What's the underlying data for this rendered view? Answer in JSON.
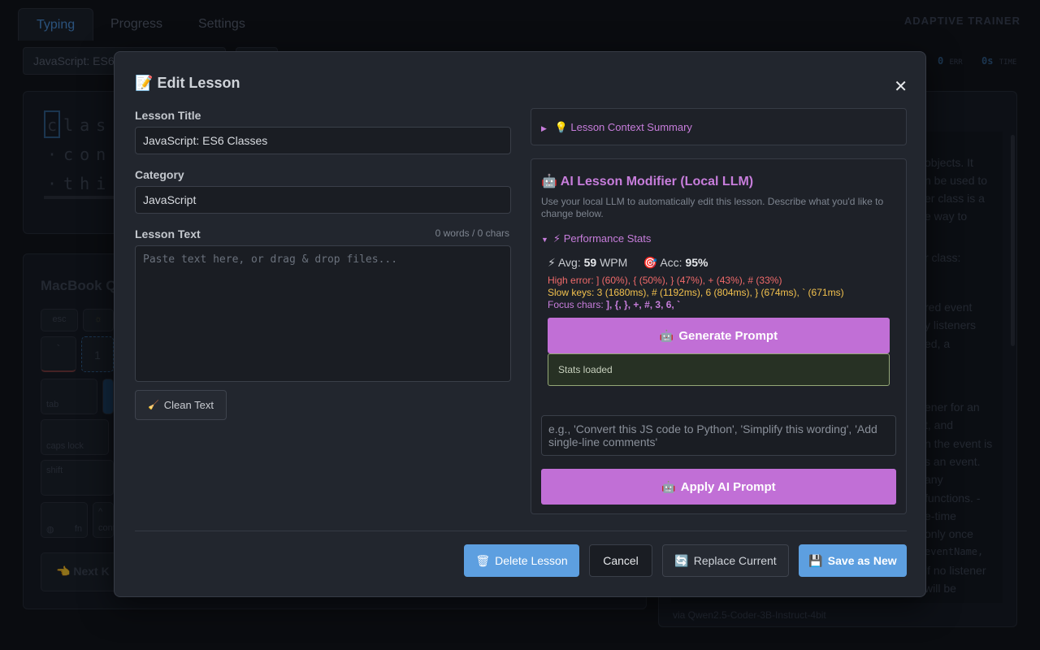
{
  "app": {
    "tabs": [
      {
        "label": "Typing",
        "active": true
      },
      {
        "label": "Progress",
        "active": false
      },
      {
        "label": "Settings",
        "active": false
      }
    ],
    "brand": "ADAPTIVE TRAINER",
    "lesson_select_value": "JavaScript: ES6",
    "stats": [
      {
        "value": "0",
        "unit": "ERR"
      },
      {
        "value": "0s",
        "unit": "TIME"
      }
    ],
    "typing_lines": [
      "class",
      "·con",
      "·thi"
    ],
    "keyboard_title": "MacBook Q",
    "keys": [
      "esc",
      "☼",
      "`",
      "1",
      "tab",
      "caps lock",
      "shift",
      "fn",
      "^",
      "cont"
    ],
    "next_key_label": "Next K",
    "ai_text_lines": [
      "objects. It",
      "n be used to",
      "er class is a",
      "e way to",
      "r class:",
      "red event",
      "y listeners",
      "ed, a",
      "ener for an",
      "t, and",
      "n the event is",
      "s an event.",
      "any",
      "functions. -",
      "e-time",
      "only once",
      "eventName,",
      "lf no listener",
      "will be"
    ],
    "via": "via Qwen2.5-Coder-3B-Instruct-4bit"
  },
  "modal": {
    "title_icon": "📝",
    "title": "Edit Lesson",
    "close_label": "✕",
    "lesson_title_label": "Lesson Title",
    "lesson_title_value": "JavaScript: ES6 Classes",
    "category_label": "Category",
    "category_value": "JavaScript",
    "lesson_text_label": "Lesson Text",
    "lesson_text_count": "0 words / 0 chars",
    "lesson_text_placeholder": "Paste text here, or drag & drop files...",
    "clean_text_icon": "🧹",
    "clean_text_label": "Clean Text",
    "context_summary": {
      "triangle": "▶",
      "icon": "💡",
      "label": "Lesson Context Summary"
    },
    "ai_modifier": {
      "icon": "🤖",
      "title": "AI Lesson Modifier (Local LLM)",
      "description": "Use your local LLM to automatically edit this lesson. Describe what you'd like to change below.",
      "perf_triangle": "▼",
      "perf_icon": "⚡",
      "perf_label": "Performance Stats",
      "avg_icon": "⚡",
      "avg_label": "Avg:",
      "avg_value": "59",
      "avg_unit": "WPM",
      "acc_icon": "🎯",
      "acc_label": "Acc:",
      "acc_value": "95%",
      "high_error": "High error: ] (60%), { (50%), } (47%), + (43%), # (33%)",
      "slow_keys": "Slow keys: 3 (1680ms), # (1192ms), 6 (804ms), } (674ms), ` (671ms)",
      "focus_label": "Focus chars:",
      "focus_chars": "], {, }, +, #, 3, 6, `",
      "generate_icon": "🤖",
      "generate_label": "Generate Prompt",
      "status": "Stats loaded",
      "prompt_placeholder": "e.g., 'Convert this JS code to Python', 'Simplify this wording', 'Add single-line comments'",
      "apply_icon": "🤖",
      "apply_label": "Apply AI Prompt"
    },
    "footer": {
      "delete_icon": "🗑",
      "delete_label": "Delete Lesson",
      "cancel_label": "Cancel",
      "replace_icon": "🔄",
      "replace_label": "Replace Current",
      "save_icon": "💾",
      "save_label": "Save as New"
    }
  }
}
